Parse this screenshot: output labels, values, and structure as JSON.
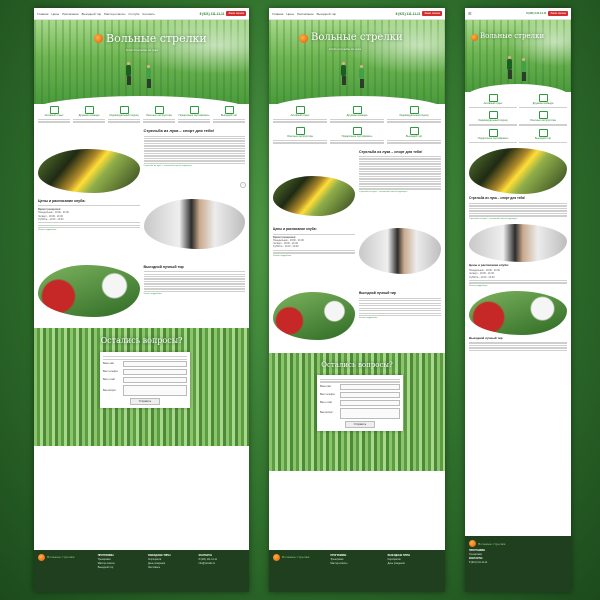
{
  "colors": {
    "accent": "#2e7d32",
    "cta": "#d32f2f",
    "footer": "#1f3f1f"
  },
  "nav": [
    "Главная",
    "Цены",
    "Расписание",
    "Выездной тир",
    "Мастер-классы",
    "О клубе",
    "Контакты"
  ],
  "phone": "8 (921) 111-11-11",
  "callback": "Заказ звонка",
  "hero": {
    "title": "Вольные стрелки",
    "subtitle": "Клуб стрельбы из лука"
  },
  "features": [
    {
      "icon": "heart-icon",
      "title": "Активный отдых"
    },
    {
      "icon": "group-icon",
      "title": "Дружная команда"
    },
    {
      "icon": "person-icon",
      "title": "Индивидуальный подход"
    },
    {
      "icon": "archer-icon",
      "title": "Опытные инструкторы"
    },
    {
      "icon": "gift-icon",
      "title": "Подарочные сертификаты"
    },
    {
      "icon": "target-icon",
      "title": "Выездной тир"
    }
  ],
  "about": {
    "title": "Стрельба из лука – спорт для тебя!",
    "more": "Стрельба из лука – отличный способ отдохнуть"
  },
  "prices": {
    "title": "Цены и расписание клуба:",
    "schedule_title": "Время тренировок:",
    "items": [
      "Понедельник - 19:00 - 21:00",
      "Четверг - 19:00 - 21:00",
      "Суббота - 11:00 - 13:00"
    ],
    "more": "Узнать подробнее"
  },
  "field": {
    "title": "Выездной лучный тир",
    "more": "Узнать подробнее"
  },
  "form": {
    "title": "Остались вопросы?",
    "fields": [
      "Ваше имя:",
      "Ваш телефон:",
      "Ваш e-mail:",
      "Ваш вопрос:"
    ],
    "submit": "Отправить"
  },
  "footer": {
    "brand": "Вольные стрелки",
    "col1_title": "ПРОГРАММЫ",
    "col1": [
      "Тренировки",
      "Мастер-классы",
      "Выездной тир"
    ],
    "col2_title": "ВЫЕЗДНЫЕ ТИРЫ",
    "col2": [
      "Корпоратив",
      "День рождения",
      "Фестиваль"
    ],
    "col3_title": "КОНТАКТЫ",
    "col3": [
      "8 (921) 111-11-11",
      "info@vstrelki.ru"
    ]
  }
}
